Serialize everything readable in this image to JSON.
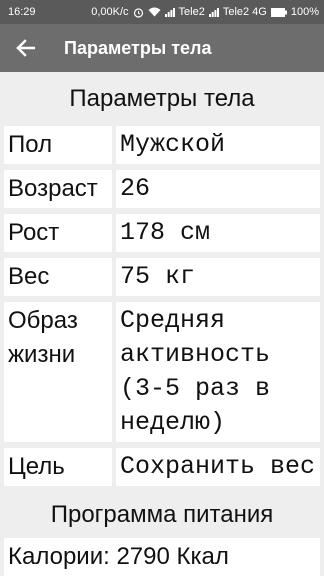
{
  "status_bar": {
    "time": "16:29",
    "speed": "0,00K/c",
    "carrier1": "Tele2",
    "carrier2": "Tele2 4G",
    "battery": "100%"
  },
  "app_bar": {
    "title": "Параметры тела",
    "back_icon": "arrow-back-icon"
  },
  "body_params": {
    "title": "Параметры тела",
    "rows": [
      {
        "label": "Пол",
        "value": "Мужской"
      },
      {
        "label": "Возраст",
        "value": "26"
      },
      {
        "label": "Рост",
        "value": "178 см"
      },
      {
        "label": "Вес",
        "value": "75 кг"
      },
      {
        "label": "Образ жизни",
        "value": "Средняя активность (3-5 раз в неделю)"
      },
      {
        "label": "Цель",
        "value": "Сохранить вес"
      }
    ]
  },
  "nutrition": {
    "title": "Программа питания",
    "calories": "Калории: 2790 Ккал"
  }
}
